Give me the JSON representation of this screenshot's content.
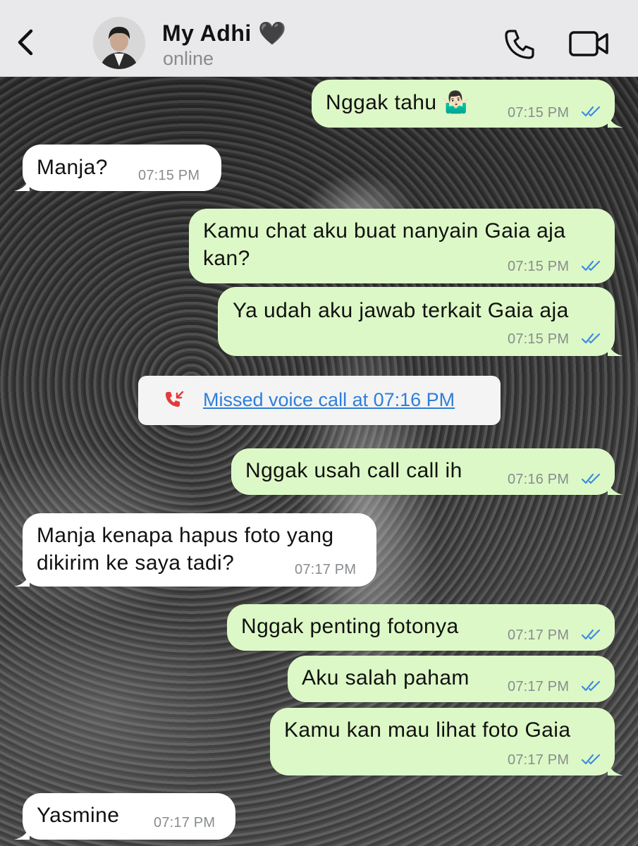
{
  "header": {
    "contact_name": "My Adhi 🖤",
    "status": "online"
  },
  "messages": [
    {
      "dir": "out",
      "text": "Nggak tahu 🤷🏻‍♂️",
      "time": "07:15 PM"
    },
    {
      "dir": "in",
      "text": "Manja?",
      "time": "07:15 PM"
    },
    {
      "dir": "out",
      "line1": "Kamu chat aku buat nanyain Gaia aja",
      "line2": "kan?",
      "time": "07:15 PM"
    },
    {
      "dir": "out",
      "text": "Ya udah aku jawab terkait Gaia aja",
      "time": "07:15 PM"
    },
    {
      "dir": "system",
      "text": "Missed voice call at 07:16 PM"
    },
    {
      "dir": "out",
      "text": "Nggak usah call call ih",
      "time": "07:16 PM"
    },
    {
      "dir": "in",
      "line1": "Manja kenapa hapus foto yang",
      "line2": "dikirim ke saya tadi?",
      "time": "07:17 PM"
    },
    {
      "dir": "out",
      "text": "Nggak penting fotonya",
      "time": "07:17 PM"
    },
    {
      "dir": "out",
      "text": "Aku salah paham",
      "time": "07:17 PM"
    },
    {
      "dir": "out",
      "text": "Kamu kan mau lihat foto Gaia",
      "time": "07:17 PM"
    },
    {
      "dir": "in",
      "text": "Yasmine",
      "time": "07:17 PM"
    }
  ],
  "colors": {
    "outgoing_bubble": "#dcf8c6",
    "incoming_bubble": "#ffffff",
    "read_ticks": "#3b8de0",
    "missed_call": "#e53935",
    "link": "#2d7fd8"
  }
}
